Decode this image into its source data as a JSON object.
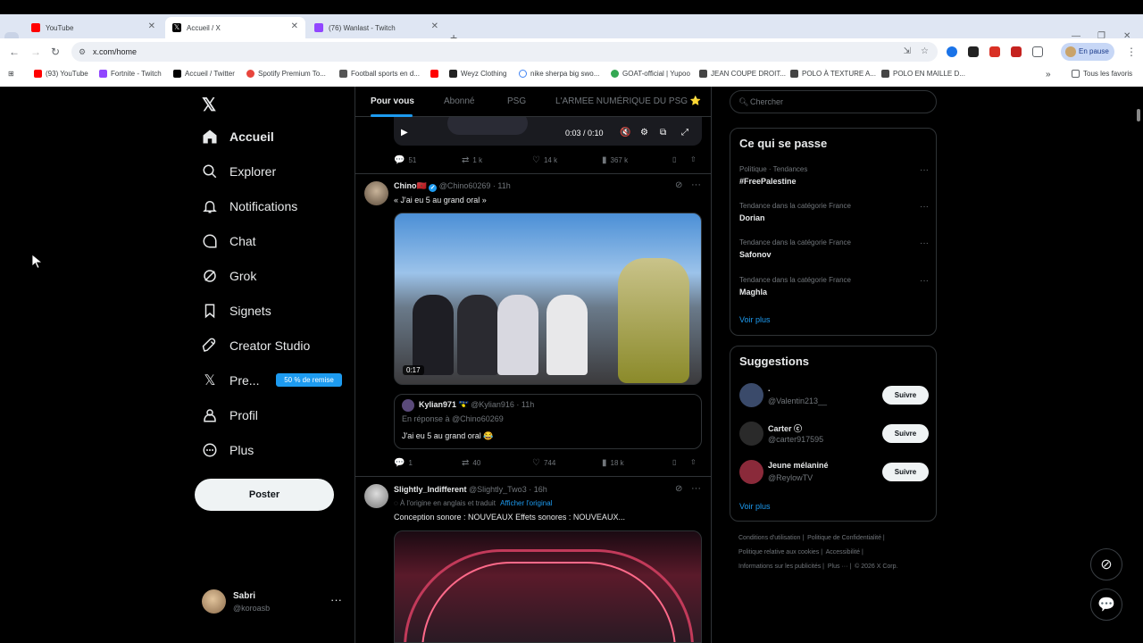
{
  "browser": {
    "tabs": [
      {
        "title": "YouTube",
        "color": "#ff0000"
      },
      {
        "title": "Accueil / X",
        "color": "#000000"
      },
      {
        "title": "(76) Wanlast - Twitch",
        "color": "#9146ff"
      }
    ],
    "url": "x.com/home",
    "profile_status": "En pause",
    "bookmarks": [
      {
        "label": "(93) YouTube",
        "color": "#ff0000"
      },
      {
        "label": "Fortnite - Twitch",
        "color": "#9146ff"
      },
      {
        "label": "Accueil / Twitter",
        "color": "#000000"
      },
      {
        "label": "Spotify Premium To...",
        "color": "#e8453c"
      },
      {
        "label": "Football sports en d...",
        "color": "#555555"
      },
      {
        "label": "",
        "color": "#ff0000"
      },
      {
        "label": "Weyz Clothing",
        "color": "#222222"
      },
      {
        "label": "nike sherpa big swo...",
        "color": "#4285f4"
      },
      {
        "label": "GOAT-official | Yupoo",
        "color": "#34a853"
      },
      {
        "label": "JEAN COUPE DROIT...",
        "color": "#444444"
      },
      {
        "label": "POLO À TEXTURE A...",
        "color": "#444444"
      },
      {
        "label": "POLO EN MAILLE D...",
        "color": "#444444"
      }
    ],
    "all_bookmarks": "Tous les favoris"
  },
  "nav": {
    "items": [
      {
        "label": "Accueil",
        "icon": "home-icon"
      },
      {
        "label": "Explorer",
        "icon": "search-icon"
      },
      {
        "label": "Notifications",
        "icon": "bell-icon"
      },
      {
        "label": "Chat",
        "icon": "chat-icon"
      },
      {
        "label": "Grok",
        "icon": "grok-icon"
      },
      {
        "label": "Signets",
        "icon": "bookmark-icon"
      },
      {
        "label": "Creator Studio",
        "icon": "rocket-icon"
      },
      {
        "label": "Pre...",
        "icon": "x-icon"
      },
      {
        "label": "Profil",
        "icon": "person-icon"
      },
      {
        "label": "Plus",
        "icon": "more-circle-icon"
      }
    ],
    "premium_promo": "50 % de remise",
    "post_button": "Poster",
    "account": {
      "name": "Sabri",
      "handle": "@koroasb"
    }
  },
  "timeline": {
    "tabs": [
      "Pour vous",
      "Abonné",
      "PSG",
      "L'ARMEE NUMÉRIQUE DU PSG ⭐"
    ],
    "video_time": "0:03 / 0:10",
    "post1_actions": {
      "replies": "51",
      "reposts": "1 k",
      "likes": "14 k",
      "views": "367 k"
    },
    "post2": {
      "name": "Chino🇲🇦",
      "handle": "@Chino60269 · 11h",
      "text": "« J'ai eu 5 au grand oral »",
      "duration": "0:17",
      "quote": {
        "name": "Kylian971 🇬🇵",
        "handle": "@Kylian916 · 11h",
        "reply_to": "En réponse à @Chino60269",
        "text": "J'ai eu 5 au grand oral 😂"
      },
      "actions": {
        "replies": "1",
        "reposts": "40",
        "likes": "744",
        "views": "18 k"
      }
    },
    "post3": {
      "name": "Slightly_Indifferent",
      "handle": "@Slightly_Two3 · 16h",
      "translated": "À l'origine en anglais et traduit",
      "show_original": "Afficher l'original",
      "text": "Conception sonore : NOUVEAUX Effets sonores : NOUVEAUX..."
    }
  },
  "sidebar": {
    "search_placeholder": "Chercher",
    "trends_title": "Ce qui se passe",
    "trends": [
      {
        "context": "Politique · Tendances",
        "name": "#FreePalestine"
      },
      {
        "context": "Tendance dans la catégorie France",
        "name": "Dorian"
      },
      {
        "context": "Tendance dans la catégorie France",
        "name": "Safonov"
      },
      {
        "context": "Tendance dans la catégorie France",
        "name": "Maghla"
      }
    ],
    "trends_more": "Voir plus",
    "suggestions_title": "Suggestions",
    "suggestions": [
      {
        "name": ".",
        "handle": "@Valentin213__",
        "button": "Suivre",
        "color": "#3a4a6a"
      },
      {
        "name": "Carter ⓒ",
        "handle": "@carter917595",
        "button": "Suivre",
        "color": "#2a2a2a"
      },
      {
        "name": "Jeune mélaniné",
        "handle": "@ReylowTV",
        "button": "Suivre",
        "color": "#8a2a3a"
      }
    ],
    "suggestions_more": "Voir plus",
    "footer": [
      "Conditions d'utilisation |",
      "Politique de Confidentialité |",
      "Politique relative aux cookies |",
      "Accessibilité |",
      "Informations sur les publicités |",
      "Plus ··· |",
      "© 2026 X Corp."
    ]
  }
}
